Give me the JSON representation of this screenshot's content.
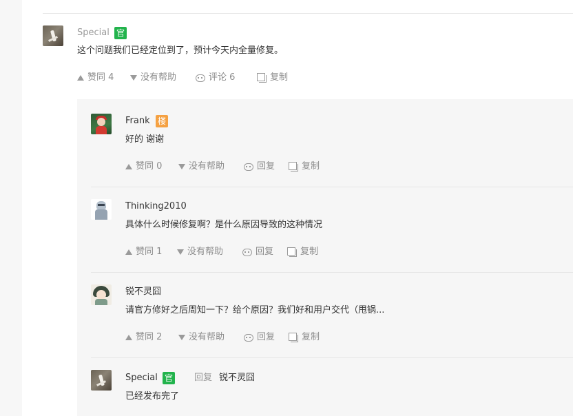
{
  "main_comment": {
    "author": "Special",
    "badge": "官",
    "text": "这个问题我们已经定位到了，预计今天内全量修复。",
    "actions": {
      "upvote": "赞同 4",
      "not_helpful": "没有帮助",
      "comments": "评论 6",
      "copy": "复制"
    }
  },
  "replies": [
    {
      "author": "Frank",
      "badge": "楼",
      "text": "好的 谢谢",
      "actions": {
        "upvote": "赞同 0",
        "not_helpful": "没有帮助",
        "reply": "回复",
        "copy": "复制"
      }
    },
    {
      "author": "Thinking2010",
      "text": "具体什么时候修复啊？是什么原因导致的这种情况",
      "actions": {
        "upvote": "赞同 1",
        "not_helpful": "没有帮助",
        "reply": "回复",
        "copy": "复制"
      }
    },
    {
      "author": "锐不灵囧",
      "text": "请官方修好之后周知一下？给个原因？我们好和用户交代（甩锅...",
      "actions": {
        "upvote": "赞同 2",
        "not_helpful": "没有帮助",
        "reply": "回复",
        "copy": "复制"
      }
    },
    {
      "author": "Special",
      "badge": "官",
      "reply_label": "回复",
      "reply_target": "锐不灵囧",
      "text": "已经发布完了"
    }
  ],
  "colors": {
    "official_badge": "#22b34c",
    "floor_badge": "#f5a142",
    "muted_text": "#8c8c8c"
  },
  "icons": {
    "upvote": "triangle-up-icon",
    "not_helpful": "triangle-down-icon",
    "comment": "comment-bubble-icon",
    "copy": "copy-icon"
  }
}
